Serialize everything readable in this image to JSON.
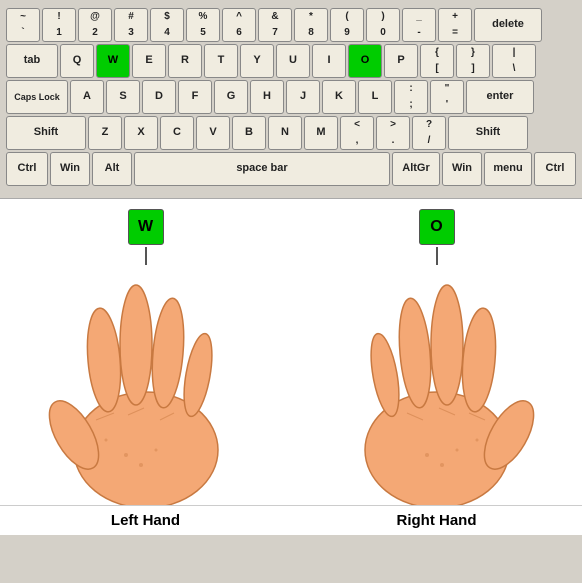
{
  "keyboard": {
    "rows": [
      [
        {
          "label": "`\n~",
          "cls": "std"
        },
        {
          "label": "1\n!",
          "cls": "std"
        },
        {
          "label": "2\n@",
          "cls": "std"
        },
        {
          "label": "3\n#",
          "cls": "std"
        },
        {
          "label": "4\n$",
          "cls": "std"
        },
        {
          "label": "5\n%",
          "cls": "std"
        },
        {
          "label": "6\n^",
          "cls": "std"
        },
        {
          "label": "7\n&",
          "cls": "std"
        },
        {
          "label": "8\n*",
          "cls": "std"
        },
        {
          "label": "9\n(",
          "cls": "std"
        },
        {
          "label": "0\n)",
          "cls": "std"
        },
        {
          "label": "-\n_",
          "cls": "std"
        },
        {
          "label": "=\n+",
          "cls": "std"
        },
        {
          "label": "delete",
          "cls": "wide-delete"
        }
      ],
      [
        {
          "label": "tab",
          "cls": "wide-tab"
        },
        {
          "label": "Q",
          "cls": "std"
        },
        {
          "label": "W",
          "cls": "std green"
        },
        {
          "label": "E",
          "cls": "std"
        },
        {
          "label": "R",
          "cls": "std"
        },
        {
          "label": "T",
          "cls": "std"
        },
        {
          "label": "Y",
          "cls": "std"
        },
        {
          "label": "U",
          "cls": "std"
        },
        {
          "label": "I",
          "cls": "std"
        },
        {
          "label": "O",
          "cls": "std green"
        },
        {
          "label": "P",
          "cls": "std"
        },
        {
          "label": "[\n{",
          "cls": "std"
        },
        {
          "label": "]\n}",
          "cls": "std"
        },
        {
          "label": "\\\n|",
          "cls": "wide-backslash"
        }
      ],
      [
        {
          "label": "Caps Lock",
          "cls": "wide-capslock"
        },
        {
          "label": "A",
          "cls": "std"
        },
        {
          "label": "S",
          "cls": "std"
        },
        {
          "label": "D",
          "cls": "std"
        },
        {
          "label": "F",
          "cls": "std"
        },
        {
          "label": "G",
          "cls": "std"
        },
        {
          "label": "H",
          "cls": "std"
        },
        {
          "label": "J",
          "cls": "std"
        },
        {
          "label": "K",
          "cls": "std"
        },
        {
          "label": "L",
          "cls": "std"
        },
        {
          "label": ";\n:",
          "cls": "std"
        },
        {
          "label": "'\n\"",
          "cls": "std"
        },
        {
          "label": "enter",
          "cls": "wide-enter"
        }
      ],
      [
        {
          "label": "Shift",
          "cls": "wide-shift-l"
        },
        {
          "label": "Z",
          "cls": "std"
        },
        {
          "label": "X",
          "cls": "std"
        },
        {
          "label": "C",
          "cls": "std"
        },
        {
          "label": "V",
          "cls": "std"
        },
        {
          "label": "B",
          "cls": "std"
        },
        {
          "label": "N",
          "cls": "std"
        },
        {
          "label": "M",
          "cls": "std"
        },
        {
          "label": ",\n<",
          "cls": "std"
        },
        {
          "label": ".\n>",
          "cls": "std"
        },
        {
          "label": "/\n?",
          "cls": "std"
        },
        {
          "label": "Shift",
          "cls": "wide-shift-r"
        }
      ],
      [
        {
          "label": "Ctrl",
          "cls": "wide-ctrl"
        },
        {
          "label": "Win",
          "cls": "wide-win"
        },
        {
          "label": "Alt",
          "cls": "wide-alt"
        },
        {
          "label": "space bar",
          "cls": "wide-space"
        },
        {
          "label": "AltGr",
          "cls": "wide-altgr"
        },
        {
          "label": "Win",
          "cls": "wide-win"
        },
        {
          "label": "menu",
          "cls": "wide-menu"
        },
        {
          "label": "Ctrl",
          "cls": "wide-ctrl"
        }
      ]
    ]
  },
  "hands": {
    "left": {
      "key": "W",
      "label": "Left Hand"
    },
    "right": {
      "key": "O",
      "label": "Right Hand"
    }
  }
}
